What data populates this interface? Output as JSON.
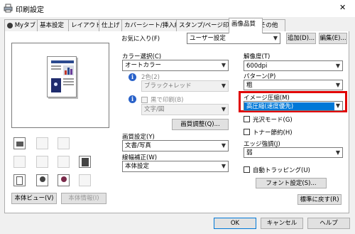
{
  "window": {
    "title": "印刷設定",
    "close_glyph": "✕"
  },
  "tabs": [
    {
      "label": "Myタブ"
    },
    {
      "label": "基本設定"
    },
    {
      "label": "レイアウト"
    },
    {
      "label": "仕上げ"
    },
    {
      "label": "カバーシート/挿入紙"
    },
    {
      "label": "スタンプ/ページ印字"
    },
    {
      "label": "画像品質"
    },
    {
      "label": "その他"
    }
  ],
  "favorites": {
    "label": "お気に入り(F)",
    "value": "ユーザー設定",
    "add_button": "追加(D)...",
    "edit_button": "編集(E)..."
  },
  "color_select": {
    "label": "カラー選択(C)",
    "value": "オートカラー"
  },
  "two_color": {
    "label": "2色(2)",
    "value": "ブラック+レッド"
  },
  "black_print": {
    "label": "黒で印刷(B)",
    "value": "文字/図"
  },
  "image_adjust_button": "画質調整(Q)...",
  "quality_setting": {
    "label": "画質設定(Y)",
    "value": "文書/写真"
  },
  "line_correction": {
    "label": "線幅補正(W)",
    "value": "本体設定"
  },
  "resolution": {
    "label": "解像度(T)",
    "value": "600dpi"
  },
  "pattern": {
    "label": "パターン(P)",
    "value": "粗"
  },
  "image_compression": {
    "label": "イメージ圧縮(M)",
    "value": "高圧縮(速度優先)"
  },
  "glossy_mode": {
    "label": "光沢モード(G)"
  },
  "toner_save": {
    "label": "トナー節約(H)"
  },
  "edge_enhance": {
    "label": "エッジ強調(J)",
    "value": "弱"
  },
  "auto_trapping": {
    "label": "自動トラッピング(U)"
  },
  "font_settings_button": "フォント設定(S)...",
  "main_view_button": "本体ビュー(V)",
  "main_info_button": "本体情報(I)",
  "restore_default_button": "標準に戻す(R)",
  "footer": {
    "ok": "OK",
    "cancel": "キャンセル",
    "help": "ヘルプ"
  },
  "colors": {
    "highlight_border": "#e00000",
    "selection_bg": "#0078d7"
  }
}
